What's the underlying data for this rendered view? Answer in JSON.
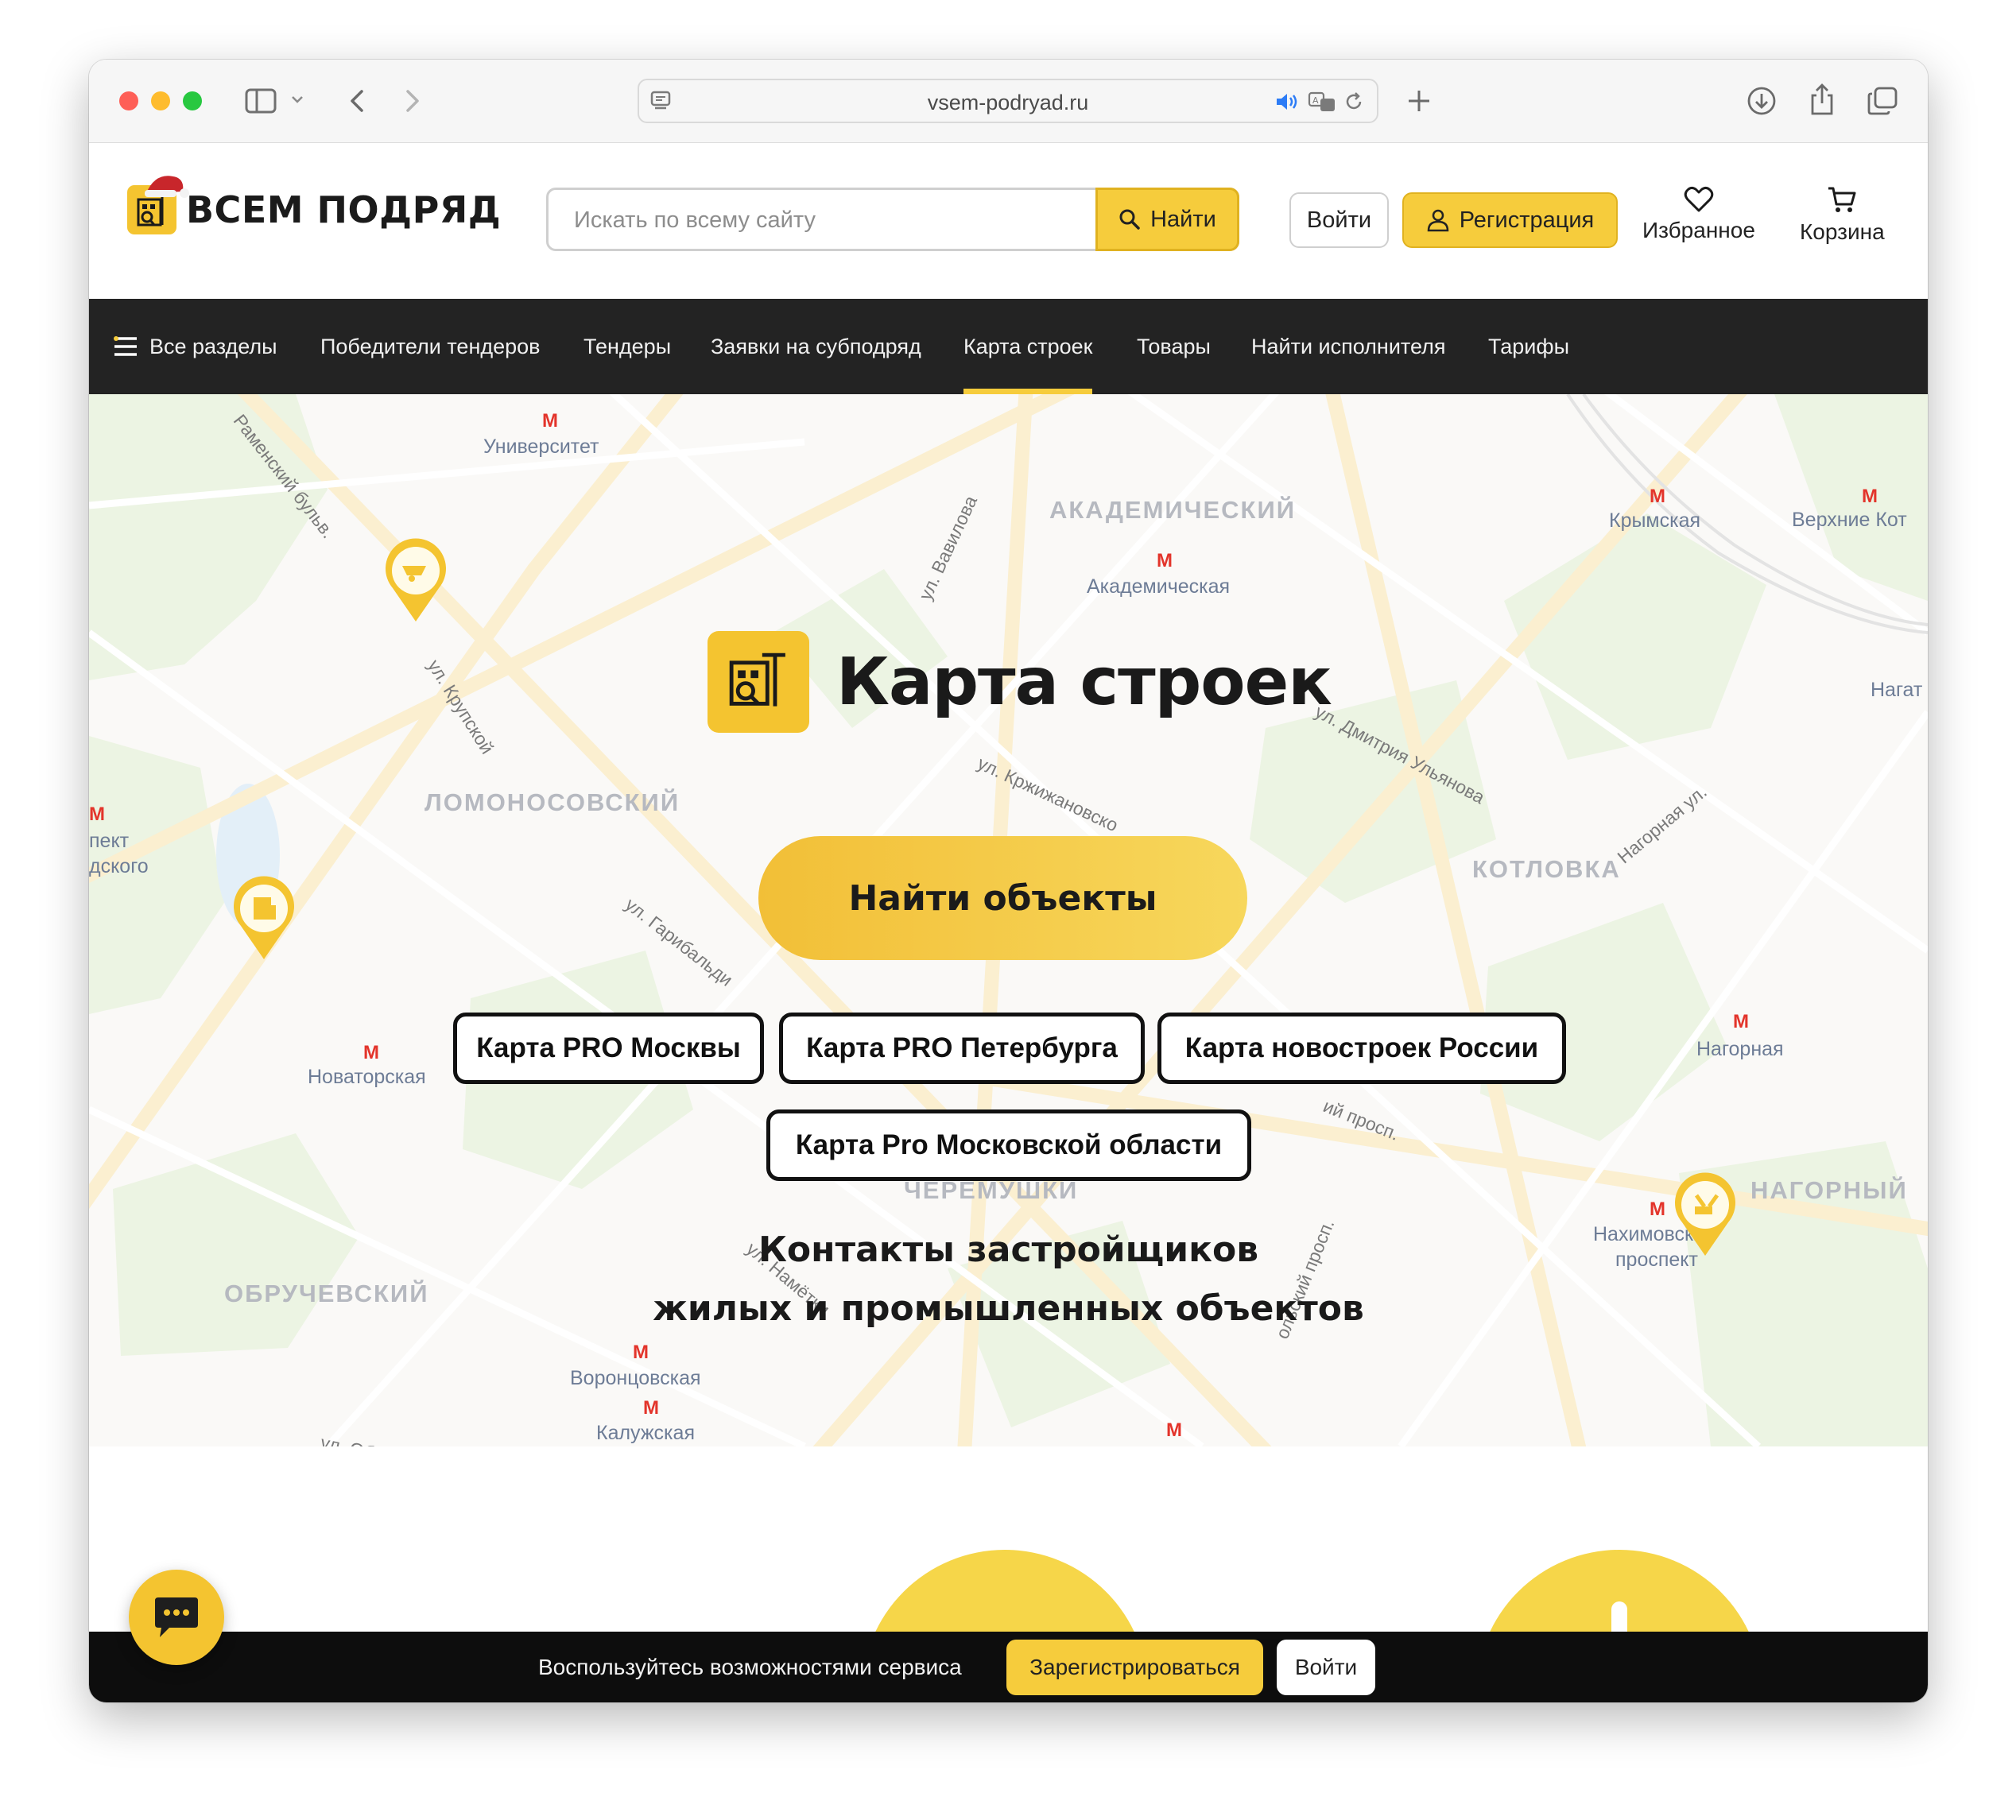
{
  "browser": {
    "url": "vsem-podryad.ru"
  },
  "header": {
    "logo_text": "ВСЕМ ПОДРЯД",
    "search_placeholder": "Искать по всему сайту",
    "search_button": "Найти",
    "login_button": "Войти",
    "register_button": "Регистрация",
    "favorites": "Избранное",
    "cart": "Корзина"
  },
  "nav": {
    "items": [
      {
        "label": "Все разделы"
      },
      {
        "label": "Победители тендеров"
      },
      {
        "label": "Тендеры"
      },
      {
        "label": "Заявки на субподряд"
      },
      {
        "label": "Карта строек",
        "active": true
      },
      {
        "label": "Товары"
      },
      {
        "label": "Найти исполнителя"
      },
      {
        "label": "Тарифы"
      }
    ]
  },
  "hero": {
    "title": "Карта строек",
    "cta": "Найти объекты",
    "map_links": [
      "Карта PRO Москвы",
      "Карта PRO Петербурга",
      "Карта новостроек России",
      "Карта Pro Московской области"
    ],
    "subtitle_line1": "Контакты застройщиков",
    "subtitle_line2": "жилых и промышленных объектов"
  },
  "map": {
    "districts": [
      "АКАДЕМИЧЕСКИЙ",
      "ЛОМОНОСОВСКИЙ",
      "КОТЛОВКА",
      "ЧЕРЁМУШКИ",
      "ОБРУЧЕВСКИЙ",
      "НАГОРНЫЙ"
    ],
    "stations": [
      "Университет",
      "Академическая",
      "Крымская",
      "Верхние Кот",
      "Нагат",
      "Новаторская",
      "Нагорная",
      "Нахимовский",
      "проспект",
      "Воронцовская",
      "Калужская",
      "пект",
      "дского"
    ],
    "streets": [
      "Раменский бульв.",
      "ул. Вавилова",
      "ул. Крупской",
      "ул. Кржижановско",
      "ул. Дмитрия Ульянова",
      "Нагорная ул.",
      "ул. Гарибальди",
      "ий просп.",
      "ул. Намётки",
      "ольский просп.",
      "ул. Обручева"
    ],
    "pin_icons": [
      "wheelbarrow-icon",
      "building-icon",
      "excavator-icon"
    ]
  },
  "bottom_bar": {
    "text": "Воспользуйтесь возможностями сервиса",
    "register": "Зарегистрироваться",
    "login": "Войти"
  },
  "colors": {
    "accent": "#f6cc3c",
    "nav_bg": "#232323",
    "bottom_bar_bg": "#0d0d0d"
  }
}
